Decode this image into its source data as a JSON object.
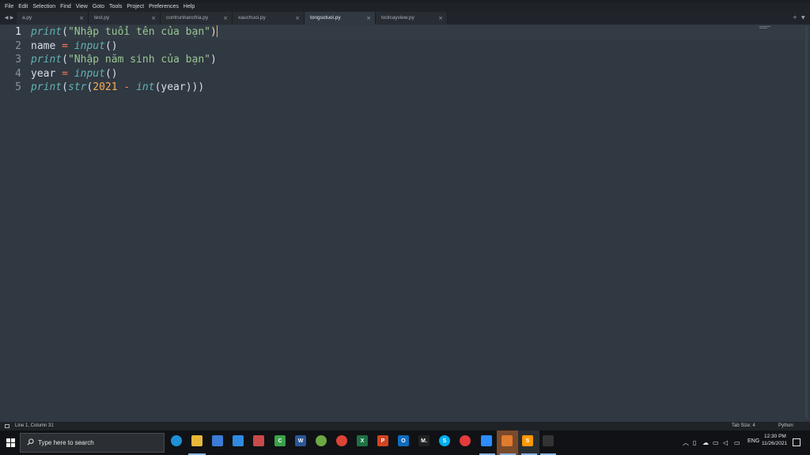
{
  "menu": [
    "File",
    "Edit",
    "Selection",
    "Find",
    "View",
    "Goto",
    "Tools",
    "Project",
    "Preferences",
    "Help"
  ],
  "tabs": [
    {
      "label": "a.py",
      "close": "×"
    },
    {
      "label": "test.py",
      "close": "×"
    },
    {
      "label": "contrunhanchia.py",
      "close": "×"
    },
    {
      "label": "xauchuoi.py",
      "close": "×"
    },
    {
      "label": "tongsotuoi.py",
      "close": "×",
      "active": true
    },
    {
      "label": "toolcayview.py",
      "close": "×"
    }
  ],
  "tab_controls": {
    "prev": "◀",
    "next": "▶",
    "new": "+",
    "list": "▼"
  },
  "editor": {
    "line_numbers": [
      "1",
      "2",
      "3",
      "4",
      "5"
    ],
    "current_line": 1,
    "lines": [
      {
        "tokens": [
          [
            "fn",
            "print"
          ],
          [
            "plain",
            "("
          ],
          [
            "str",
            "\"Nhập tuổi tên của bạn\""
          ],
          [
            "plain",
            ")"
          ]
        ],
        "cursor": true
      },
      {
        "tokens": [
          [
            "plain",
            "name "
          ],
          [
            "op",
            "="
          ],
          [
            "plain",
            " "
          ],
          [
            "fn",
            "input"
          ],
          [
            "plain",
            "()"
          ]
        ]
      },
      {
        "tokens": [
          [
            "fn",
            "print"
          ],
          [
            "plain",
            "("
          ],
          [
            "str",
            "\"Nhập năm sinh của bạn\""
          ],
          [
            "plain",
            ")"
          ]
        ]
      },
      {
        "tokens": [
          [
            "plain",
            "year "
          ],
          [
            "op",
            "="
          ],
          [
            "plain",
            " "
          ],
          [
            "fn",
            "input"
          ],
          [
            "plain",
            "()"
          ]
        ]
      },
      {
        "tokens": [
          [
            "fn",
            "print"
          ],
          [
            "plain",
            "("
          ],
          [
            "fn",
            "str"
          ],
          [
            "plain",
            "("
          ],
          [
            "num",
            "2021"
          ],
          [
            "plain",
            " "
          ],
          [
            "op",
            "-"
          ],
          [
            "plain",
            " "
          ],
          [
            "fn",
            "int"
          ],
          [
            "plain",
            "(year)))"
          ]
        ]
      }
    ],
    "colors": {
      "background": "#303841",
      "function": "#5fb4b4",
      "string": "#99c794",
      "number": "#f9ae58",
      "operator": "#f97b58",
      "text": "#d8dee9"
    }
  },
  "status": {
    "position": "Line 1, Column 31",
    "tab_size": "Tab Size: 4",
    "syntax": "Python"
  },
  "taskbar": {
    "search_placeholder": "Type here to search",
    "apps": [
      {
        "name": "edge-icon",
        "label": "",
        "color": "#1f8fd6"
      },
      {
        "name": "file-explorer-icon",
        "label": "",
        "color": "#e8b73a"
      },
      {
        "name": "store-icon",
        "label": "",
        "color": "#3c7bd6"
      },
      {
        "name": "mail-icon",
        "label": "",
        "color": "#2f8ae0"
      },
      {
        "name": "app-grid-icon",
        "label": "",
        "color": "#c94a4a"
      },
      {
        "name": "camtasia-icon",
        "label": "C",
        "color": "#3aa24a"
      },
      {
        "name": "word-icon",
        "label": "W",
        "color": "#2b5797"
      },
      {
        "name": "greenshot-icon",
        "label": "",
        "color": "#6ca843"
      },
      {
        "name": "chrome-icon",
        "label": "",
        "color": "#db4437"
      },
      {
        "name": "excel-icon",
        "label": "X",
        "color": "#1e7145"
      },
      {
        "name": "powerpoint-icon",
        "label": "P",
        "color": "#d04423"
      },
      {
        "name": "outlook-icon",
        "label": "O",
        "color": "#0f6cbd"
      },
      {
        "name": "medium-icon",
        "label": "M.",
        "color": "#222222"
      },
      {
        "name": "skype-icon",
        "label": "S",
        "color": "#00aff0"
      },
      {
        "name": "record-icon",
        "label": "",
        "color": "#e23b3b"
      },
      {
        "name": "zoom-icon",
        "label": "",
        "color": "#2d8cff"
      },
      {
        "name": "pen-tool-icon",
        "label": "",
        "color": "#e07a2e"
      },
      {
        "name": "sublime-text-icon",
        "label": "S",
        "color": "#ff9800"
      },
      {
        "name": "terminal-icon",
        "label": "",
        "color": "#333333"
      }
    ],
    "language": "ENG",
    "time": "12:30 PM",
    "date": "11/26/2021"
  }
}
